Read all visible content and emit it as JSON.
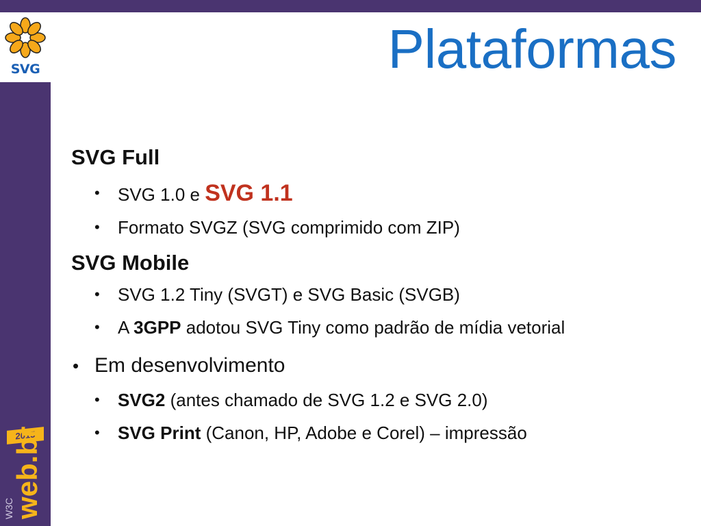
{
  "colors": {
    "frame": "#4a3470",
    "title": "#1a6fc4",
    "accent_red": "#c0321e",
    "logo_orange": "#f6a81a"
  },
  "logo": {
    "text": "SVG",
    "icon": "svg-flower-icon"
  },
  "brand": {
    "year": "2015",
    "icon": "w3c-webbr-logo"
  },
  "title": "Plataformas",
  "sections": {
    "full": {
      "heading": "SVG Full",
      "item1_prefix": "SVG 1.0 e ",
      "item1_highlight": "SVG 1.1",
      "item2": "Formato SVGZ (SVG comprimido com ZIP)"
    },
    "mobile": {
      "heading": "SVG Mobile",
      "item1": "SVG 1.2 Tiny (SVGT) e SVG Basic (SVGB)",
      "item2_prefix": "A ",
      "item2_bold": "3GPP",
      "item2_suffix": " adotou SVG Tiny como padrão de mídia vetorial"
    },
    "dev": {
      "heading": "Em desenvolvimento",
      "item1_bold": "SVG2",
      "item1_suffix": " (antes chamado de SVG 1.2 e SVG 2.0)",
      "item2_bold": "SVG Print",
      "item2_suffix": " (Canon, HP, Adobe e Corel) – impressão"
    }
  }
}
